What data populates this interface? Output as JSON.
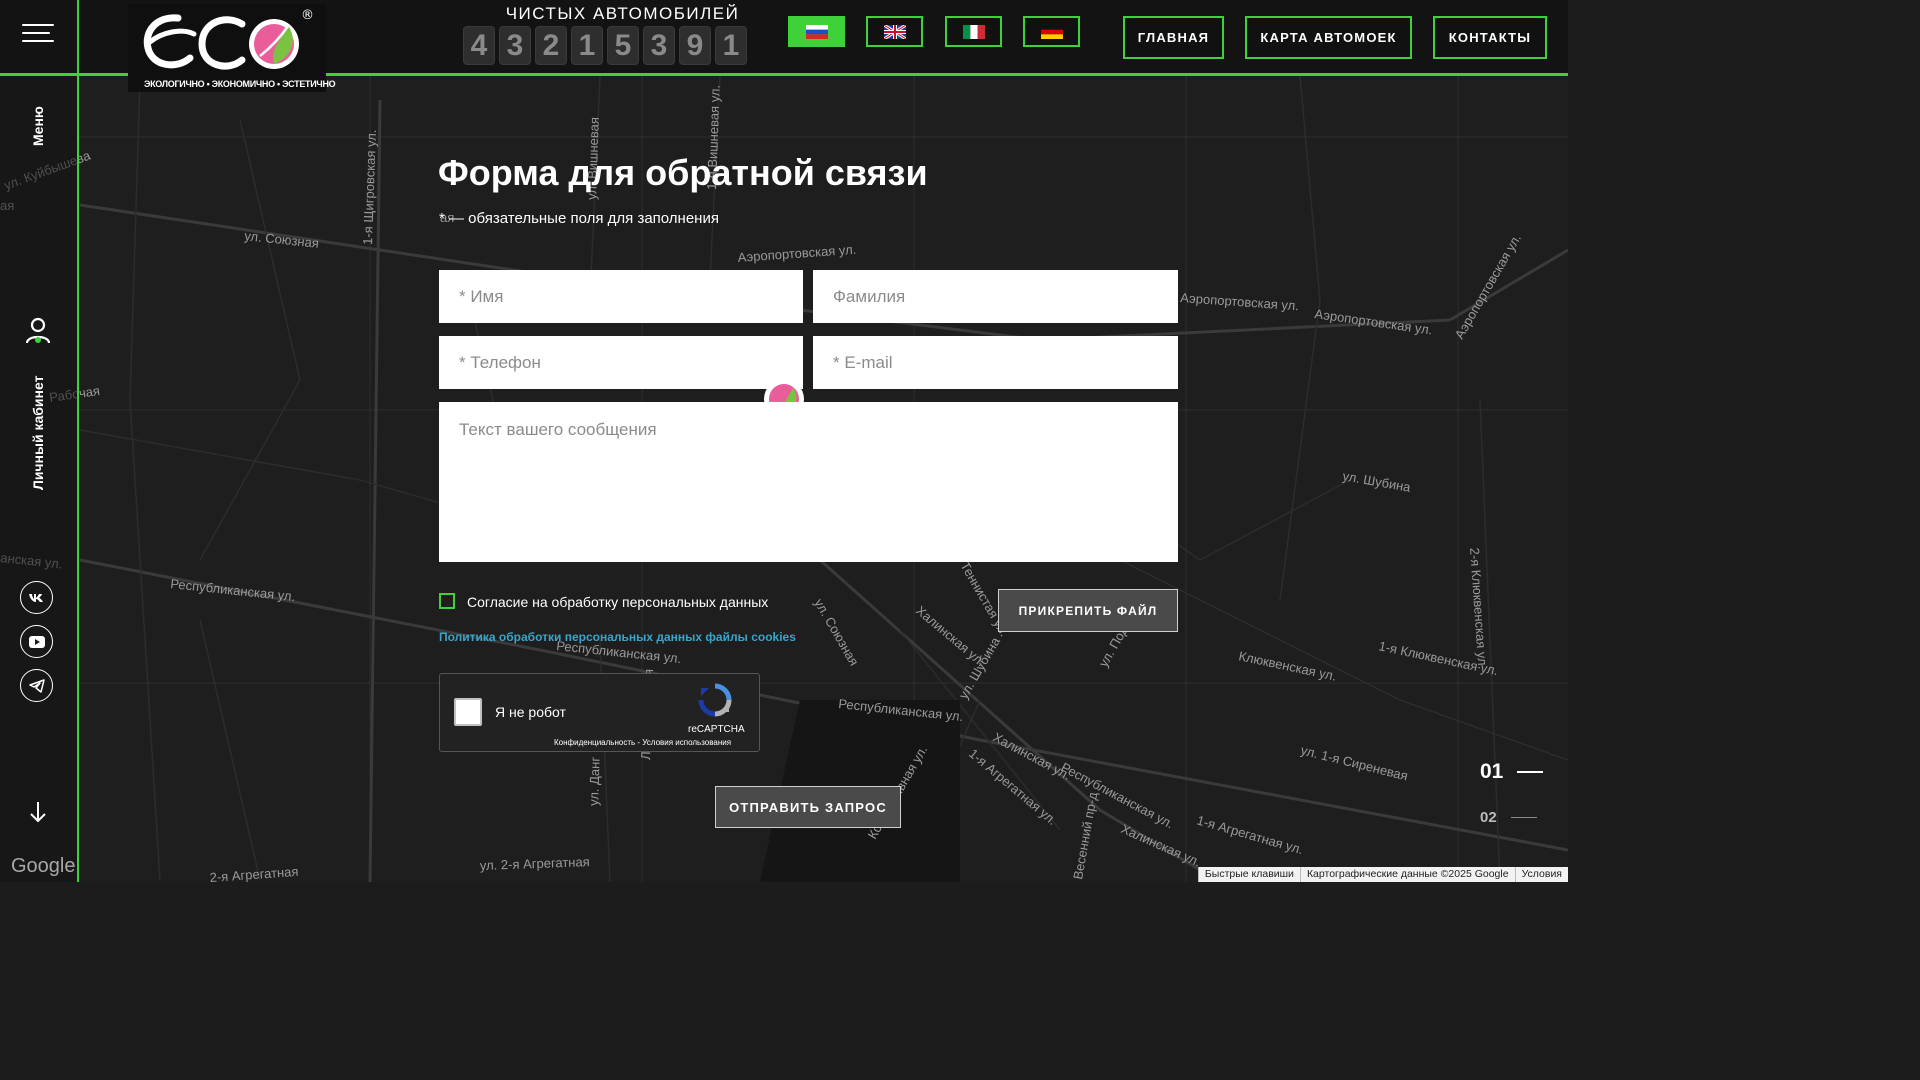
{
  "header": {
    "menu_icon": "hamburger-icon",
    "logo": {
      "text": "eco",
      "registered": "®",
      "tagline": "ЭКОЛОГИЧНО • ЭКОНОМИЧНО • ЭСТЕТИЧНО"
    },
    "counter": {
      "title": "ЧИСТЫХ АВТОМОБИЛЕЙ",
      "digits": [
        "4",
        "3",
        "2",
        "1",
        "5",
        "3",
        "9",
        "1"
      ]
    },
    "languages": [
      {
        "code": "ru",
        "flag": "russia-flag",
        "active": true
      },
      {
        "code": "en",
        "flag": "uk-flag",
        "active": false
      },
      {
        "code": "it",
        "flag": "italy-flag",
        "active": false
      },
      {
        "code": "de",
        "flag": "germany-flag",
        "active": false
      }
    ],
    "nav": [
      {
        "label": "ГЛАВНАЯ"
      },
      {
        "label": "КАРТА АВТОМОЕК"
      },
      {
        "label": "КОНТАКТЫ"
      }
    ]
  },
  "sidebar": {
    "menu_label": "Меню",
    "cabinet_label": "Личный кабинет",
    "cabinet_icon": "user-icon",
    "socials": [
      {
        "name": "vk",
        "icon": "vk-icon"
      },
      {
        "name": "youtube",
        "icon": "youtube-icon"
      },
      {
        "name": "telegram",
        "icon": "telegram-icon"
      }
    ],
    "scroll_icon": "arrow-down-icon"
  },
  "form": {
    "title": "Форма для обратной связи",
    "required_note": "* — обязательные поля для заполнения",
    "fields": {
      "first_name": {
        "placeholder": "* Имя",
        "value": ""
      },
      "last_name": {
        "placeholder": "Фамилия",
        "value": ""
      },
      "phone": {
        "placeholder": "* Телефон",
        "value": ""
      },
      "email": {
        "placeholder": "* E-mail",
        "value": ""
      },
      "message": {
        "placeholder": "Текст вашего сообщения",
        "value": ""
      }
    },
    "consent_label": "Согласие на обработку персональных данных",
    "consent_checked": false,
    "policy_link": "Политика обработки персональных данных файлы cookies",
    "attach_button": "ПРИКРЕПИТЬ ФАЙЛ",
    "recaptcha": {
      "label": "Я не робот",
      "brand": "reCAPTCHA",
      "terms": "Конфиденциальность - Условия использования"
    },
    "submit_button": "ОТПРАВИТЬ ЗАПРОС"
  },
  "pager": [
    {
      "label": "01",
      "active": true
    },
    {
      "label": "02",
      "active": false
    }
  ],
  "map": {
    "streets": [
      "ул. Союзная",
      "1-я Щигровская ул.",
      "Аэропортовская ул.",
      "ул. Вишневая",
      "1-я Вишневая ул.",
      "ул. Куйбышева",
      "Рабочая",
      "Республиканская ул.",
      "Республиканская ул.",
      "Республиканская ул.",
      "Республиканская ул.",
      "Аэропортовская ул.",
      "Аэропортовская ул.",
      "Аэропортовская ул.",
      "ул. Шубина",
      "ул. Шубина",
      "Халинская ул.",
      "Халинская ул.",
      "Халинская ул.",
      "1-я Клюквенская ул.",
      "Клюквенская ул.",
      "2-я Клюквенская ул.",
      "ул. 1-я Сиреневая",
      "1-я Агрегатная ул.",
      "1-я Агрегатная ул.",
      "ул. 2-я Агрегатная",
      "ул. Подлесная",
      "Теннистая ул.",
      "Коллективная ул.",
      "ул. Союзная",
      "ул. Данг",
      "Ленинградская",
      "2-я Агрегатная",
      "Весенний пр-д",
      "ая",
      "ая",
      "анская ул."
    ],
    "google_logo": "Google",
    "footer": [
      {
        "label": "Быстрые клавиши"
      },
      {
        "label": "Картографические данные ©2025 Google"
      },
      {
        "label": "Условия"
      }
    ]
  },
  "colors": {
    "accent": "#3ed13a",
    "link": "#3aa5c9",
    "background": "#1c1c1c"
  }
}
